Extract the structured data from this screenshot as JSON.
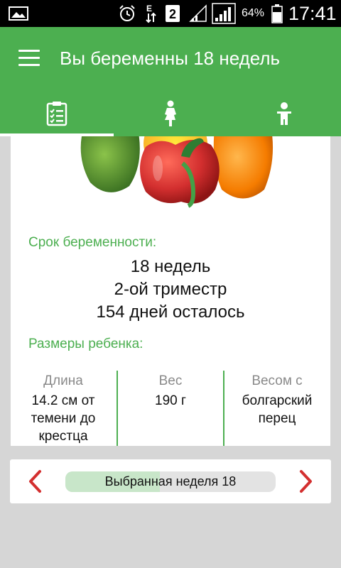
{
  "status_bar": {
    "battery": "64%",
    "time": "17:41",
    "network_type": "E",
    "sim_slot": "2",
    "icons": [
      "image-notification-icon",
      "alarm-icon",
      "data-arrows-icon",
      "sim-2-icon",
      "signal-icon",
      "signal-icon",
      "battery-icon"
    ]
  },
  "app_bar": {
    "title": "Вы беременны 18 недель",
    "menu_icon": "hamburger-menu-icon",
    "tabs": [
      {
        "icon": "clipboard-checklist-icon",
        "selected": true
      },
      {
        "icon": "pregnant-woman-icon",
        "selected": false
      },
      {
        "icon": "baby-icon",
        "selected": false
      }
    ]
  },
  "card": {
    "image": "bell-peppers",
    "term_label": "Срок беременности:",
    "term_lines": [
      "18 недель",
      "2-ой триместр",
      "154 дней осталось"
    ],
    "size_label": "Размеры ребенка:",
    "metrics": [
      {
        "label": "Длина",
        "value": "14.2 см от темени до крестца"
      },
      {
        "label": "Вес",
        "value": "190 г"
      },
      {
        "label": "Весом с",
        "value": "болгарский перец"
      }
    ]
  },
  "week_selector": {
    "text": "Выбранная неделя 18",
    "progress": 0.45,
    "prev_icon": "chevron-left-icon",
    "next_icon": "chevron-right-icon"
  },
  "colors": {
    "primary": "#4caf50",
    "accent_red": "#d32f2f",
    "progress_fill": "#c8e6c9",
    "progress_track": "#e3e3e3"
  }
}
